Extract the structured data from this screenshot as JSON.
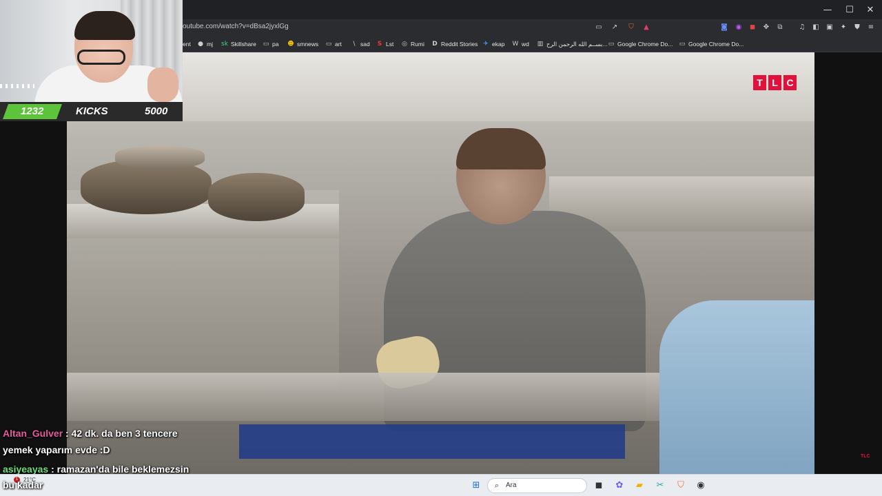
{
  "browser": {
    "url": "outube.com/watch?v=dBsa2jyxlGg",
    "window_controls": {
      "minimize": "—",
      "maximize": "☐",
      "close": "✕"
    },
    "bookmarks": [
      {
        "label": "ent",
        "icon": "none"
      },
      {
        "label": "mj",
        "icon": "github-icon"
      },
      {
        "label": "Skillshare",
        "icon": "skillshare-icon"
      },
      {
        "label": "pa",
        "icon": "folder-icon"
      },
      {
        "label": "smnews",
        "icon": "smile-icon"
      },
      {
        "label": "art",
        "icon": "folder-icon"
      },
      {
        "label": "sad",
        "icon": "slash-icon"
      },
      {
        "label": "Lst",
        "icon": "s-logo-icon"
      },
      {
        "label": "Rumi",
        "icon": "globe-icon"
      },
      {
        "label": "Reddit Stories",
        "icon": "d-logo-icon"
      },
      {
        "label": "ekap",
        "icon": "bird-icon"
      },
      {
        "label": "wd",
        "icon": "w-logo-icon"
      },
      {
        "label": "بســم الله الرحمن الرح...",
        "icon": "page-icon"
      },
      {
        "label": "Google Chrome Do...",
        "icon": "folder-icon"
      },
      {
        "label": "Google Chrome Do...",
        "icon": "folder-icon"
      }
    ]
  },
  "stream_overlay": {
    "goal_current": "1232",
    "goal_label": "KICKS",
    "goal_target": "5000",
    "goal_progress": 0.2464,
    "goal_color": "#5cc33a"
  },
  "video": {
    "channel_logo": [
      "T",
      "L",
      "C"
    ],
    "channel_logo_small": "TLC",
    "logo_color": "#e0123b"
  },
  "chat": [
    {
      "user": "Altan_Gulver",
      "message": ": 42 dk. da ben 3 tencere"
    },
    {
      "user": "",
      "message": "yemek yaparım evde :D"
    },
    {
      "user": "asiyeayas",
      "message": ": ramazan'da bile beklemezsin"
    },
    {
      "user": "",
      "message": "bu kadar"
    }
  ],
  "taskbar": {
    "search_placeholder": "Ara",
    "weather": "21°C",
    "notification_count": "1"
  }
}
